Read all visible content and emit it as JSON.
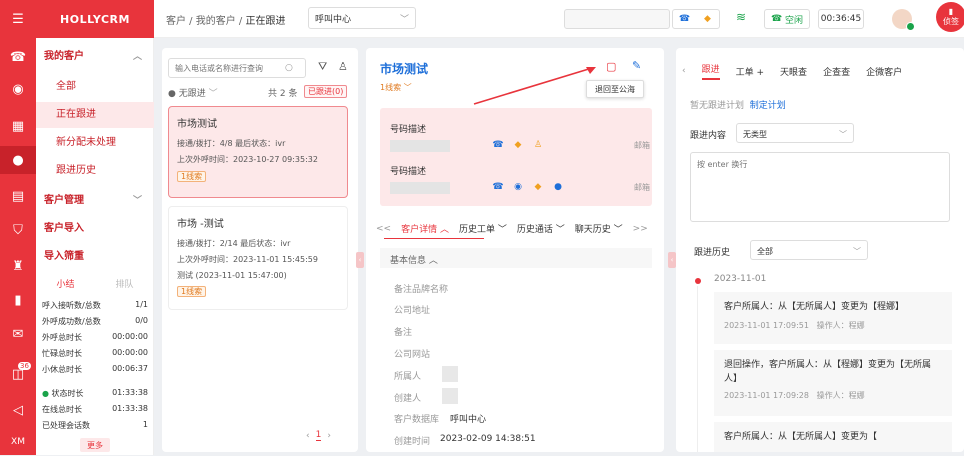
{
  "app": {
    "brand": "HOLLYCRM",
    "rail_badge": "36",
    "rail_bottom": "XM"
  },
  "nav": {
    "my_customers": "我的客户",
    "items": [
      "全部",
      "正在跟进",
      "新分配未处理",
      "跟进历史"
    ],
    "customer_mgmt": "客户管理",
    "customer_import": "客户导入",
    "import_filter": "导入筛重"
  },
  "summary": {
    "tabs": [
      "小结",
      "排队"
    ],
    "rows": [
      [
        "呼入接听数/总数",
        "1/1"
      ],
      [
        "外呼成功数/总数",
        "0/0"
      ],
      [
        "外呼总时长",
        "00:00:00"
      ],
      [
        "忙碌总时长",
        "00:00:00"
      ],
      [
        "小休总时长",
        "00:06:37"
      ]
    ],
    "status_rows": [
      [
        "状态时长",
        "01:33:38"
      ],
      [
        "在线总时长",
        "01:33:38"
      ],
      [
        "已处理会话数",
        "1"
      ]
    ],
    "more": "更多"
  },
  "breadcrumb": [
    "客户",
    "我的客户",
    "正在跟进"
  ],
  "top": {
    "select": "呼叫中心",
    "status": "空闲",
    "timer": "00:36:45",
    "right_badge": "侦签"
  },
  "list": {
    "search_placeholder": "输入电话或名称进行查询",
    "filter": "无跟进",
    "count": "共 2 条",
    "followed_tag": "已跟进(0)",
    "cards": [
      {
        "title": "市场测试",
        "line1": "接通/拨打：4/8 最后状态：ivr",
        "line2": "上次外呼时间：2023-10-27 09:35:32",
        "line3": "",
        "tag": "1线索"
      },
      {
        "title": "市场  -测试",
        "line1": "接通/拨打：2/14 最后状态：ivr",
        "line2": "上次外呼时间：2023-11-01 15:45:59",
        "line3": "测试 (2023-11-01 15:47:00)",
        "tag": "1线索"
      }
    ],
    "page": "1"
  },
  "detail": {
    "title": "市场测试",
    "subtitle": "1线索",
    "tooltip": "退回至公海",
    "phones": [
      {
        "label": "号码描述",
        "right": "邮箱"
      },
      {
        "label": "号码描述",
        "right": "邮箱"
      }
    ],
    "tabs": [
      "客户详情",
      "历史工单",
      "历史通话",
      "聊天历史"
    ],
    "basic": "基本信息",
    "fields": [
      [
        "备注品牌名称",
        ""
      ],
      [
        "公司地址",
        ""
      ],
      [
        "备注",
        ""
      ],
      [
        "公司网站",
        ""
      ],
      [
        "所属人",
        ""
      ],
      [
        "创建人",
        ""
      ],
      [
        "客户数据库",
        "呼叫中心"
      ],
      [
        "创建时间",
        "2023-02-09 14:38:51"
      ]
    ]
  },
  "right": {
    "tabs": [
      "跟进",
      "工单",
      "天眼查",
      "企查查",
      "企微客户"
    ],
    "no_plan": "暂无跟进计划",
    "make_plan": "制定计划",
    "content_label": "跟进内容",
    "content_value": "无类型",
    "textarea_placeholder": "按 enter 换行",
    "history_label": "跟进历史",
    "history_value": "全部",
    "date": "2023-11-01",
    "entries": [
      {
        "text": "客户所属人：从【无所属人】变更为【程娜】",
        "time": "2023-11-01 17:09:51",
        "op": "操作人：程娜"
      },
      {
        "text": "退回操作，客户所属人：从【程娜】变更为【无所属人】",
        "time": "2023-11-01 17:09:28",
        "op": "操作人：程娜"
      },
      {
        "text": "客户所属人：从【无所属人】变更为【",
        "time": "",
        "op": ""
      }
    ]
  },
  "colors": {
    "brand": "#e8343c",
    "accent": "#1e6fd9",
    "success": "#1aa34a"
  }
}
